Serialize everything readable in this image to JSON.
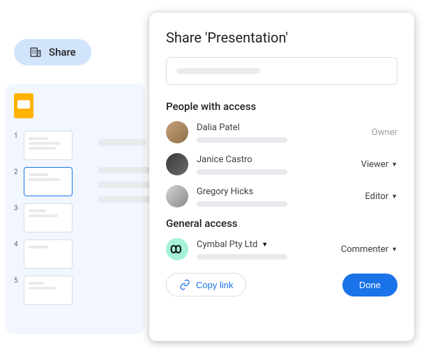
{
  "shareButton": {
    "label": "Share"
  },
  "thumbnails": [
    "1",
    "2",
    "3",
    "4",
    "5"
  ],
  "dialog": {
    "title": "Share 'Presentation'",
    "sectionPeople": "People with access",
    "sectionGeneral": "General access",
    "people": [
      {
        "name": "Dalia Patel",
        "role": "Owner",
        "roleMuted": true,
        "hasCaret": false
      },
      {
        "name": "Janice Castro",
        "role": "Viewer",
        "roleMuted": false,
        "hasCaret": true
      },
      {
        "name": "Gregory Hicks",
        "role": "Editor",
        "roleMuted": false,
        "hasCaret": true
      }
    ],
    "org": {
      "name": "Cymbal Pty Ltd",
      "role": "Commenter"
    },
    "copyLink": "Copy link",
    "done": "Done"
  }
}
